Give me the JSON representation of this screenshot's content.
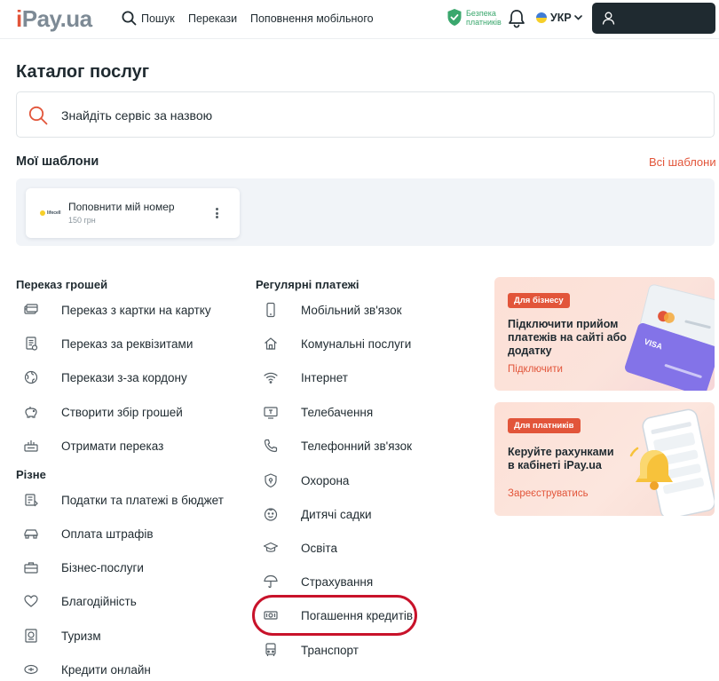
{
  "header": {
    "logo_i": "i",
    "logo_rest": "Pay.ua",
    "search_label": "Пошук",
    "nav_transfers": "Перекази",
    "nav_mobile": "Поповнення мобільного",
    "safety_line1": "Безпека",
    "safety_line2": "платників",
    "lang": "УКР"
  },
  "catalog": {
    "title": "Каталог послуг",
    "search_placeholder": "Знайдіть сервіс за назвою"
  },
  "templates": {
    "title": "Мої шаблони",
    "all_link": "Всі шаблони",
    "items": [
      {
        "name": "Поповнити мій номер",
        "amount": "150 грн",
        "logo_text": "lifecell"
      }
    ]
  },
  "money_transfer": {
    "title": "Переказ грошей",
    "items": [
      {
        "label": "Переказ з картки на картку",
        "icon": "card-transfer-icon"
      },
      {
        "label": "Переказ за реквізитами",
        "icon": "requisites-icon"
      },
      {
        "label": "Перекази з-за кордону",
        "icon": "globe-icon"
      },
      {
        "label": "Створити збір грошей",
        "icon": "piggy-bank-icon"
      },
      {
        "label": "Отримати переказ",
        "icon": "receive-money-icon"
      }
    ]
  },
  "misc": {
    "title": "Різне",
    "items": [
      {
        "label": "Податки та платежі в бюджет",
        "icon": "tax-icon"
      },
      {
        "label": "Оплата штрафів",
        "icon": "car-icon"
      },
      {
        "label": "Бізнес-послуги",
        "icon": "briefcase-icon"
      },
      {
        "label": "Благодійність",
        "icon": "heart-icon"
      },
      {
        "label": "Туризм",
        "icon": "passport-icon"
      },
      {
        "label": "Кредити онлайн",
        "icon": "credit-online-icon"
      }
    ]
  },
  "regular": {
    "title": "Регулярні платежі",
    "items": [
      {
        "label": "Мобільний зв'язок",
        "icon": "mobile-phone-icon"
      },
      {
        "label": "Комунальні послуги",
        "icon": "house-icon"
      },
      {
        "label": "Інтернет",
        "icon": "wifi-icon"
      },
      {
        "label": "Телебачення",
        "icon": "tv-icon"
      },
      {
        "label": "Телефонний зв'язок",
        "icon": "phone-handset-icon"
      },
      {
        "label": "Охорона",
        "icon": "shield-icon"
      },
      {
        "label": "Дитячі садки",
        "icon": "child-face-icon"
      },
      {
        "label": "Освіта",
        "icon": "graduation-cap-icon"
      },
      {
        "label": "Страхування",
        "icon": "umbrella-icon"
      },
      {
        "label": "Погашення кредитів",
        "icon": "loan-repayment-icon"
      },
      {
        "label": "Транспорт",
        "icon": "bus-icon"
      }
    ]
  },
  "promos": [
    {
      "badge": "Для бізнесу",
      "title_lines": [
        "Підключити прийом",
        "платежів на сайті або",
        "додатку"
      ],
      "link": "Підключити"
    },
    {
      "badge": "Для платників",
      "title_lines": [
        "Керуйте рахунками",
        "в кабінеті iPay.ua"
      ],
      "link": "Зареєструватись"
    }
  ],
  "colors": {
    "brand": "#e2553a",
    "dark": "#1f2a30",
    "safety_green": "#3aa76d",
    "highlight": "#c8122a"
  }
}
